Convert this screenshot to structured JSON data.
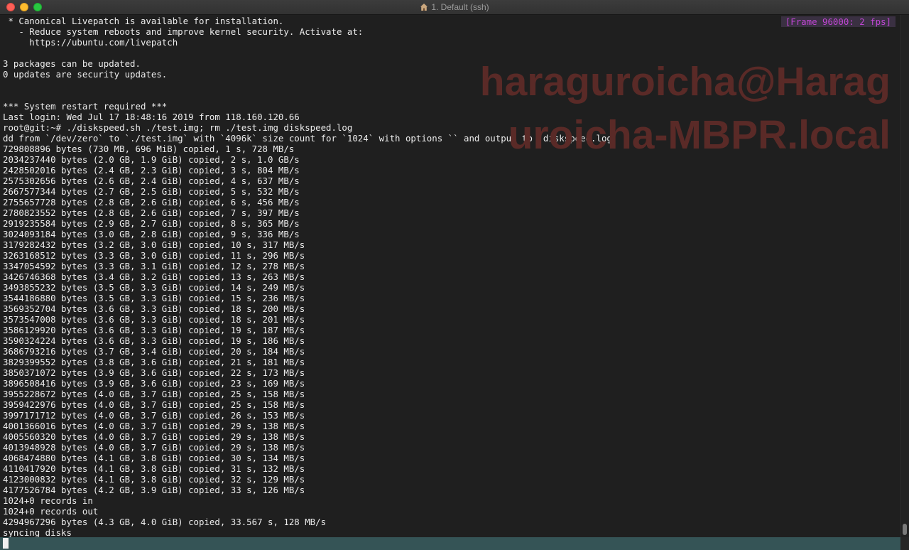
{
  "window": {
    "title": "1. Default (ssh)",
    "title_icon": "home-icon"
  },
  "colors": {
    "terminal_bg": "#1f1f1f",
    "text": "#ececec",
    "frame_badge_text": "#c046d3",
    "watermark": "#5a2a27",
    "statusbar": "#355456"
  },
  "frame_badge": "[Frame 96000: 2 fps]",
  "watermark": {
    "line1": "haraguroicha@Harag",
    "line2": "uroicha-MBPR.local"
  },
  "terminal_lines": [
    " * Canonical Livepatch is available for installation.",
    "   - Reduce system reboots and improve kernel security. Activate at:",
    "     https://ubuntu.com/livepatch",
    "",
    "3 packages can be updated.",
    "0 updates are security updates.",
    "",
    "",
    "*** System restart required ***",
    "Last login: Wed Jul 17 18:48:16 2019 from 118.160.120.66",
    "root@git:~# ./diskspeed.sh ./test.img; rm ./test.img diskspeed.log",
    "dd from `/dev/zero` to `./test.img` with `4096k` size count for `1024` with options `` and output to `diskspeed.log`",
    "729808896 bytes (730 MB, 696 MiB) copied, 1 s, 728 MB/s",
    "2034237440 bytes (2.0 GB, 1.9 GiB) copied, 2 s, 1.0 GB/s",
    "2428502016 bytes (2.4 GB, 2.3 GiB) copied, 3 s, 804 MB/s",
    "2575302656 bytes (2.6 GB, 2.4 GiB) copied, 4 s, 637 MB/s",
    "2667577344 bytes (2.7 GB, 2.5 GiB) copied, 5 s, 532 MB/s",
    "2755657728 bytes (2.8 GB, 2.6 GiB) copied, 6 s, 456 MB/s",
    "2780823552 bytes (2.8 GB, 2.6 GiB) copied, 7 s, 397 MB/s",
    "2919235584 bytes (2.9 GB, 2.7 GiB) copied, 8 s, 365 MB/s",
    "3024093184 bytes (3.0 GB, 2.8 GiB) copied, 9 s, 336 MB/s",
    "3179282432 bytes (3.2 GB, 3.0 GiB) copied, 10 s, 317 MB/s",
    "3263168512 bytes (3.3 GB, 3.0 GiB) copied, 11 s, 296 MB/s",
    "3347054592 bytes (3.3 GB, 3.1 GiB) copied, 12 s, 278 MB/s",
    "3426746368 bytes (3.4 GB, 3.2 GiB) copied, 13 s, 263 MB/s",
    "3493855232 bytes (3.5 GB, 3.3 GiB) copied, 14 s, 249 MB/s",
    "3544186880 bytes (3.5 GB, 3.3 GiB) copied, 15 s, 236 MB/s",
    "3569352704 bytes (3.6 GB, 3.3 GiB) copied, 18 s, 200 MB/s",
    "3573547008 bytes (3.6 GB, 3.3 GiB) copied, 18 s, 201 MB/s",
    "3586129920 bytes (3.6 GB, 3.3 GiB) copied, 19 s, 187 MB/s",
    "3590324224 bytes (3.6 GB, 3.3 GiB) copied, 19 s, 186 MB/s",
    "3686793216 bytes (3.7 GB, 3.4 GiB) copied, 20 s, 184 MB/s",
    "3829399552 bytes (3.8 GB, 3.6 GiB) copied, 21 s, 181 MB/s",
    "3850371072 bytes (3.9 GB, 3.6 GiB) copied, 22 s, 173 MB/s",
    "3896508416 bytes (3.9 GB, 3.6 GiB) copied, 23 s, 169 MB/s",
    "3955228672 bytes (4.0 GB, 3.7 GiB) copied, 25 s, 158 MB/s",
    "3959422976 bytes (4.0 GB, 3.7 GiB) copied, 25 s, 158 MB/s",
    "3997171712 bytes (4.0 GB, 3.7 GiB) copied, 26 s, 153 MB/s",
    "4001366016 bytes (4.0 GB, 3.7 GiB) copied, 29 s, 138 MB/s",
    "4005560320 bytes (4.0 GB, 3.7 GiB) copied, 29 s, 138 MB/s",
    "4013948928 bytes (4.0 GB, 3.7 GiB) copied, 29 s, 138 MB/s",
    "4068474880 bytes (4.1 GB, 3.8 GiB) copied, 30 s, 134 MB/s",
    "4110417920 bytes (4.1 GB, 3.8 GiB) copied, 31 s, 132 MB/s",
    "4123000832 bytes (4.1 GB, 3.8 GiB) copied, 32 s, 129 MB/s",
    "4177526784 bytes (4.2 GB, 3.9 GiB) copied, 33 s, 126 MB/s",
    "1024+0 records in",
    "1024+0 records out",
    "4294967296 bytes (4.3 GB, 4.0 GiB) copied, 33.567 s, 128 MB/s",
    "syncing disks"
  ],
  "statusbar_text": ""
}
